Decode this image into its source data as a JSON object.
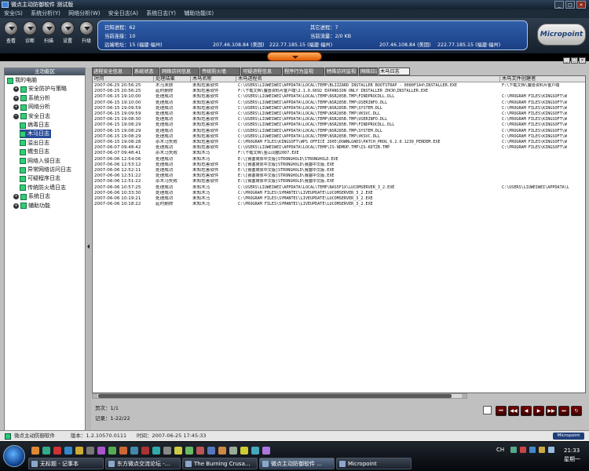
{
  "window": {
    "title": "微点主动防御软件 测试版"
  },
  "menu": [
    "安全(S)",
    "系统分析(Y)",
    "网络分析(W)",
    "安全日志(A)",
    "系统日志(Y)",
    "辅助功能(E)"
  ],
  "toolbar": [
    {
      "label": "查看",
      "icon": "view-icon"
    },
    {
      "label": "诊断",
      "icon": "diagnose-icon"
    },
    {
      "label": "扫描",
      "icon": "scan-icon"
    },
    {
      "label": "设置",
      "icon": "settings-icon"
    },
    {
      "label": "升级",
      "icon": "upgrade-icon"
    }
  ],
  "info": {
    "known_processes": "已知进程：62",
    "other_processes": "其它进程：7",
    "current_connections": "当前连接：10",
    "current_traffic": "当前流量：2/0 KB",
    "remote_address": "远端地址：15 (福建·福州)",
    "ip1": "207.46.108.84 (美国)",
    "ip2": "222.77.185.15 (福建·福州)",
    "ip3": "207.46.108.84 (美国)",
    "ip4": "222.77.185.15 (福建·福州)"
  },
  "logo": "Micropoint",
  "left_panel": {
    "title": "主功能区",
    "tree": [
      {
        "label": "我的电脑",
        "level": 0,
        "expander": "",
        "icon": "computer-icon"
      },
      {
        "label": "安全防护与策略",
        "level": 1,
        "expander": "+",
        "icon": "shield-icon"
      },
      {
        "label": "系统分析",
        "level": 1,
        "expander": "+",
        "icon": "system-icon"
      },
      {
        "label": "网络分析",
        "level": 1,
        "expander": "+",
        "icon": "network-icon"
      },
      {
        "label": "安全日志",
        "level": 1,
        "expander": "−",
        "icon": "log-icon"
      },
      {
        "label": "病毒日志",
        "level": 2,
        "expander": "",
        "icon": "virus-icon"
      },
      {
        "label": "木马日志",
        "level": 2,
        "expander": "",
        "icon": "trojan-icon",
        "selected": true
      },
      {
        "label": "溢出日志",
        "level": 2,
        "expander": "",
        "icon": "overflow-icon"
      },
      {
        "label": "蠕虫日志",
        "level": 2,
        "expander": "",
        "icon": "worm-icon"
      },
      {
        "label": "网络入侵日志",
        "level": 2,
        "expander": "",
        "icon": "intrusion-icon"
      },
      {
        "label": "异常网络访问日志",
        "level": 2,
        "expander": "",
        "icon": "abnormal-access-icon"
      },
      {
        "label": "可疑程序日志",
        "level": 2,
        "expander": "",
        "icon": "suspicious-icon"
      },
      {
        "label": "传统防火墙日志",
        "level": 2,
        "expander": "",
        "icon": "firewall-icon"
      },
      {
        "label": "系统日志",
        "level": 1,
        "expander": "+",
        "icon": "syslog-icon"
      },
      {
        "label": "辅助功能",
        "level": 1,
        "expander": "+",
        "icon": "tools-icon"
      }
    ]
  },
  "tabs": [
    "进程安全信息",
    "系统状态",
    "网络访问信息",
    "传统防火墙",
    "可疑进程信息",
    "程序行为监视",
    "特殊访问监视",
    "网络日志",
    "木马日志"
  ],
  "table": {
    "columns": [
      "时间",
      "处理结果",
      "木马名称",
      "木马进程名",
      "木马文件创建者"
    ],
    "rows": [
      [
        "2007-06-25 20:56:25",
        "木马未放",
        "未知危害软件",
        "C:\\USERS\\LIUWEIWEI\\APPDATA\\LOCAL\\TEMP\\BLIZZARD INSTALLER BOOTSTRAP - 0080F1A4\\INSTALLER.EXE",
        "F:\\下载文档\\魔兽资料片客户端"
      ],
      [
        "2007-06-25 20:56:25",
        "延时删除",
        "未知危害软件",
        "F:\\下载文档\\魔兽资料片客户端\\2.1.0.6692 EXPANSION ONLY INSTALLER ZHCN\\INSTALLER.EXE",
        ""
      ],
      [
        "2007-06-15 19:10:00",
        "处理成功",
        "未知危害软件",
        "C:\\USERS\\LIUWEIWEI\\APPDATA\\LOCAL\\TEMP\\NSR285B.TMP\\FINDPROCDLL.DLL",
        "C:\\PROGRAM FILES\\KINGSOFT\\W"
      ],
      [
        "2007-06-15 19:10:00",
        "处理成功",
        "未知危害软件",
        "C:\\USERS\\LIUWEIWEI\\APPDATA\\LOCAL\\TEMP\\NSR285B.TMP\\USERINFO.DLL",
        "C:\\PROGRAM FILES\\KINGSOFT\\W"
      ],
      [
        "2007-06-15 19:09:59",
        "处理成功",
        "未知危害软件",
        "C:\\USERS\\LIUWEIWEI\\APPDATA\\LOCAL\\TEMP\\NSR285B.TMP\\SYSTEM.DLL",
        "C:\\PROGRAM FILES\\KINGSOFT\\W"
      ],
      [
        "2007-06-15 19:09:59",
        "处理成功",
        "未知危害软件",
        "C:\\USERS\\LIUWEIWEI\\APPDATA\\LOCAL\\TEMP\\NSR285B.TMP\\VKSVC.DLL",
        "C:\\PROGRAM FILES\\KINGSOFT\\W"
      ],
      [
        "2007-06-15 19:08:30",
        "处理成功",
        "未知危害软件",
        "C:\\USERS\\LIUWEIWEI\\APPDATA\\LOCAL\\TEMP\\NSR285B.TMP\\USERINFO.DLL",
        "C:\\PROGRAM FILES\\KINGSOFT\\W"
      ],
      [
        "2007-06-15 19:08:29",
        "处理成功",
        "未知危害软件",
        "C:\\USERS\\LIUWEIWEI\\APPDATA\\LOCAL\\TEMP\\NSR285B.TMP\\FINDPROCDLL.DLL",
        "C:\\PROGRAM FILES\\KINGSOFT\\W"
      ],
      [
        "2007-06-15 19:08:29",
        "处理成功",
        "未知危害软件",
        "C:\\USERS\\LIUWEIWEI\\APPDATA\\LOCAL\\TEMP\\NSR285B.TMP\\SYSTEM.DLL",
        "C:\\PROGRAM FILES\\KINGSOFT\\W"
      ],
      [
        "2007-06-15 19:08:29",
        "处理成功",
        "未知危害软件",
        "C:\\USERS\\LIUWEIWEI\\APPDATA\\LOCAL\\TEMP\\NSR285B.TMP\\VKSVC.DLL",
        "C:\\PROGRAM FILES\\KINGSOFT\\W"
      ],
      [
        "2007-06-15 19:08:28",
        "杀木马失败",
        "未知危害软件",
        "C:\\PROGRAM FILES\\KINGSOFT\\WPS OFFICE 2005\\DOWNLOADS\\PATCH_PROG_6.2.0.1239_PERDEM.EXE",
        "C:\\PROGRAM FILES\\KINGSOFT\\W"
      ],
      [
        "2007-06-07 09:48:42",
        "处理成功",
        "未知危害软件",
        "C:\\USERS\\LIUWEIWEI\\APPDATA\\LOCAL\\TEMP\\IS-NDMOP.TMP\\IS-KDTZB.TMP",
        "C:\\PROGRAM FILES\\KINGSOFT\\W"
      ],
      [
        "2007-06-07 09:48:41",
        "杀木马失败",
        "未知木马",
        "F:\\下载文档\\金山词霸2007.EXE",
        ""
      ],
      [
        "2007-06-06 12:54:06",
        "处理成功",
        "未知木马",
        "E:\\[赛塞简体中文版]STRONGHOLD\\STRONGHOLD.EXE",
        ""
      ],
      [
        "2007-06-06 12:53:12",
        "处理成功",
        "未知危害软件",
        "E:\\[赛塞简体中文版]STRONGHOLD\\赛塞中文版.EXE",
        ""
      ],
      [
        "2007-06-06 12:52:11",
        "处理成功",
        "未知危害软件",
        "E:\\[赛塞简体中文版]STRONGHOLD\\赛塞中文版.EXE",
        ""
      ],
      [
        "2007-06-06 12:51:22",
        "处理成功",
        "未知危害软件",
        "E:\\[赛塞简体中文版]STRONGHOLD\\赛塞中文版.EXE",
        ""
      ],
      [
        "2007-06-06 12:51:22",
        "杀木马失败",
        "未知危害软件",
        "E:\\[赛塞简体中文版]STRONGHOLD\\赛塞中文版.EXE",
        ""
      ],
      [
        "2007-06-06 10:57:25",
        "处理成功",
        "未知木马",
        "C:\\USERS\\LIUWEIWEI\\APPDATA\\LOCAL\\TEMP\\NAS5F1X\\LUCOMSERVER_3_2.EXE",
        "C:\\USERS\\LIUWEIWEI\\APPDATA\\L"
      ],
      [
        "2007-06-06 10:33:30",
        "处理成功",
        "未知木马",
        "C:\\PROGRAM FILES\\SYMANTEC\\LIVEUPDATE\\LUCOMSERVER_3_2.EXE",
        ""
      ],
      [
        "2007-06-06 10:19:21",
        "处理成功",
        "未知木马",
        "C:\\PROGRAM FILES\\SYMANTEC\\LIVEUPDATE\\LUCOMSERVER_3_2.EXE",
        ""
      ],
      [
        "2007-06-06 10:18:22",
        "延时删除",
        "未知木马",
        "C:\\PROGRAM FILES\\SYMANTEC\\LIVEUPDATE\\LUCOMSERVER_3_2.EXE",
        ""
      ]
    ]
  },
  "pager": {
    "page": "页次：1/1",
    "records": "记录：1-22/22",
    "buttons": [
      "⏮",
      "◀◀",
      "◀",
      "▶",
      "▶▶",
      "⏭",
      "↻"
    ]
  },
  "statusbar": {
    "app": "微点主动防御软件",
    "version": "版本：1.2.10570.0111",
    "time": "时间：2007-06-25 17:45:33",
    "button": "Micropoint"
  },
  "taskbar": {
    "tasks": [
      "无标题 - 记事本",
      "东方微点交流论坛 -...",
      "The Burning Crusa...",
      "微点主动防御软件 ...",
      "Micropoint"
    ],
    "clock": "21:33",
    "day": "星期一",
    "lang": "CH"
  }
}
